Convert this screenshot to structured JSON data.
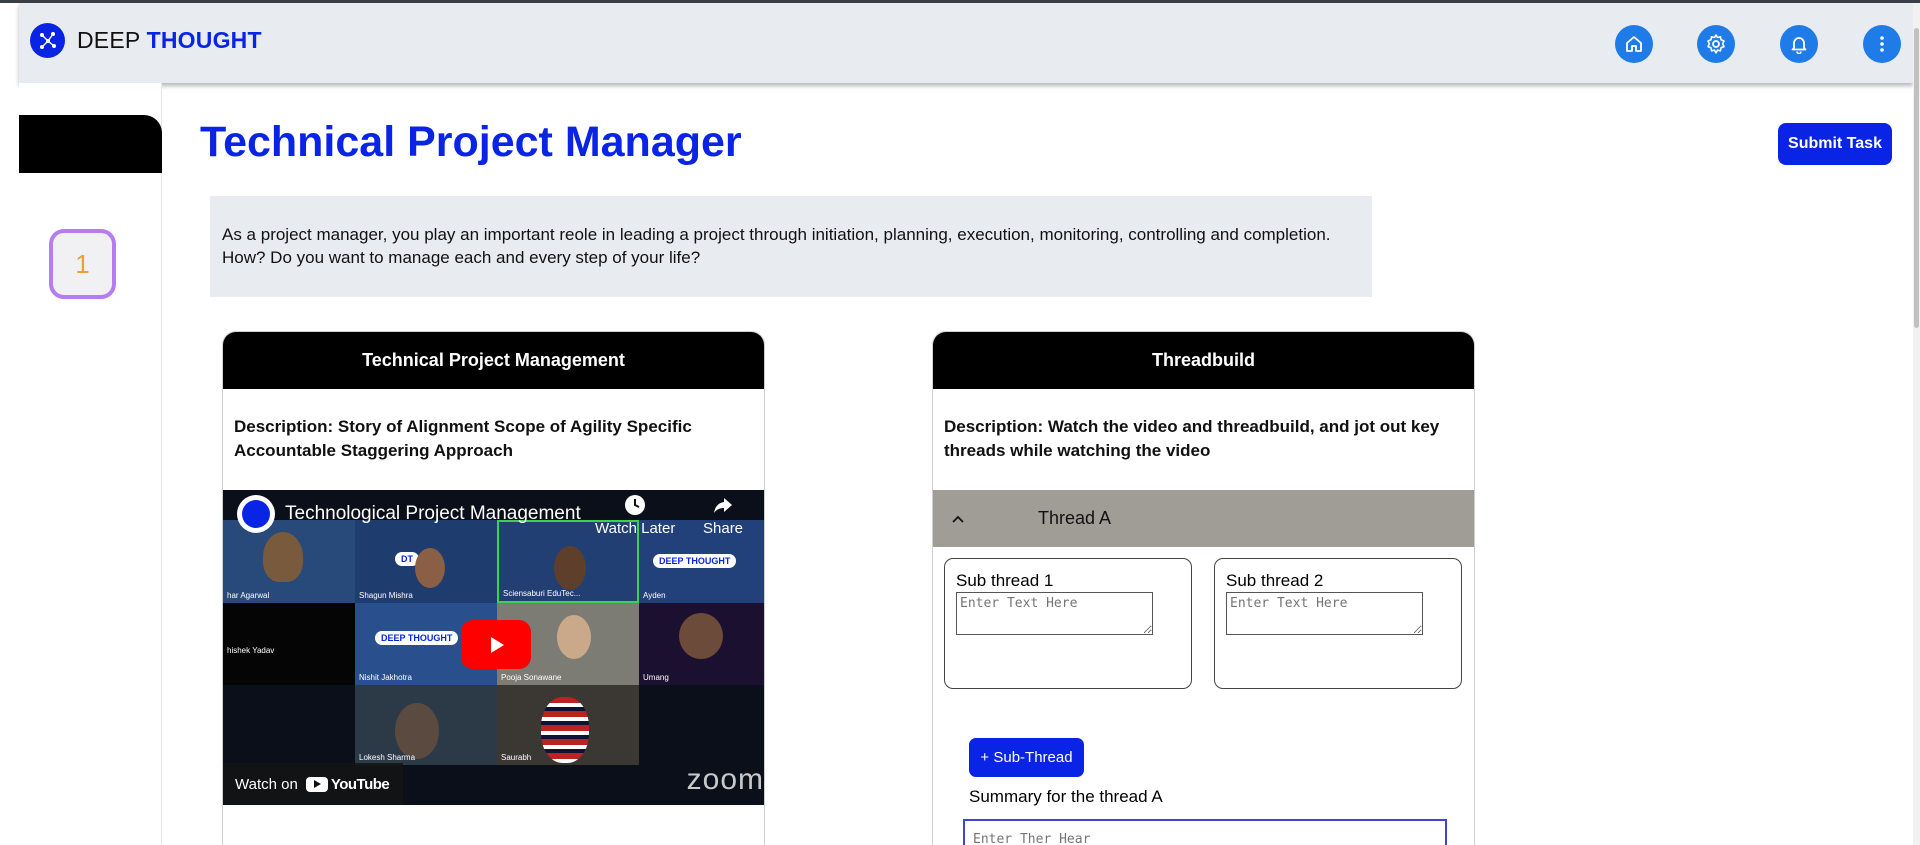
{
  "app": {
    "brand_light": "DEEP",
    "brand_bold": "THOUGHT",
    "accent_color": "#0a24e6"
  },
  "navbar": {
    "icons": [
      "home-icon",
      "settings-icon",
      "bell-icon",
      "more-vertical-icon"
    ]
  },
  "sidebar": {
    "step_number": "1"
  },
  "page": {
    "title": "Technical Project Manager",
    "submit_label": "Submit Task",
    "intro": "As a project manager, you play an important reole in leading a project through initiation, planning, execution, monitoring, controlling and completion. How? Do you want to manage each and every step of your life?"
  },
  "cards": {
    "left": {
      "title": "Technical Project Management",
      "description": "Description: Story of Alignment Scope of Agility Specific Accountable Staggering Approach",
      "video": {
        "title": "Technological Project Management",
        "watch_later": "Watch Later",
        "share": "Share",
        "watch_on": "Watch on",
        "youtube": "YouTube",
        "zoom": "zoom",
        "participants": [
          "har Agarwal",
          "Shagun Mishra",
          "Sciensaburi EduTec...",
          "Ayden",
          "hishek Yadav",
          "Nishit Jakhotra",
          "Pooja Sonawane",
          "Umang",
          "Lokesh Sharma",
          "Saurabh"
        ],
        "badge_text": "DEEP THOUGHT"
      }
    },
    "right": {
      "title": "Threadbuild",
      "description": "Description: Watch the video and threadbuild, and jot out key threads while watching the video",
      "thread": {
        "title": "Thread A",
        "subthreads": [
          {
            "label": "Sub thread 1",
            "placeholder": "Enter Text Here"
          },
          {
            "label": "Sub thread 2",
            "placeholder": "Enter Text Here"
          }
        ],
        "add_label": "+ Sub-Thread",
        "summary_label": "Summary for the thread A",
        "summary_placeholder": "Enter Ther Hear"
      }
    }
  }
}
